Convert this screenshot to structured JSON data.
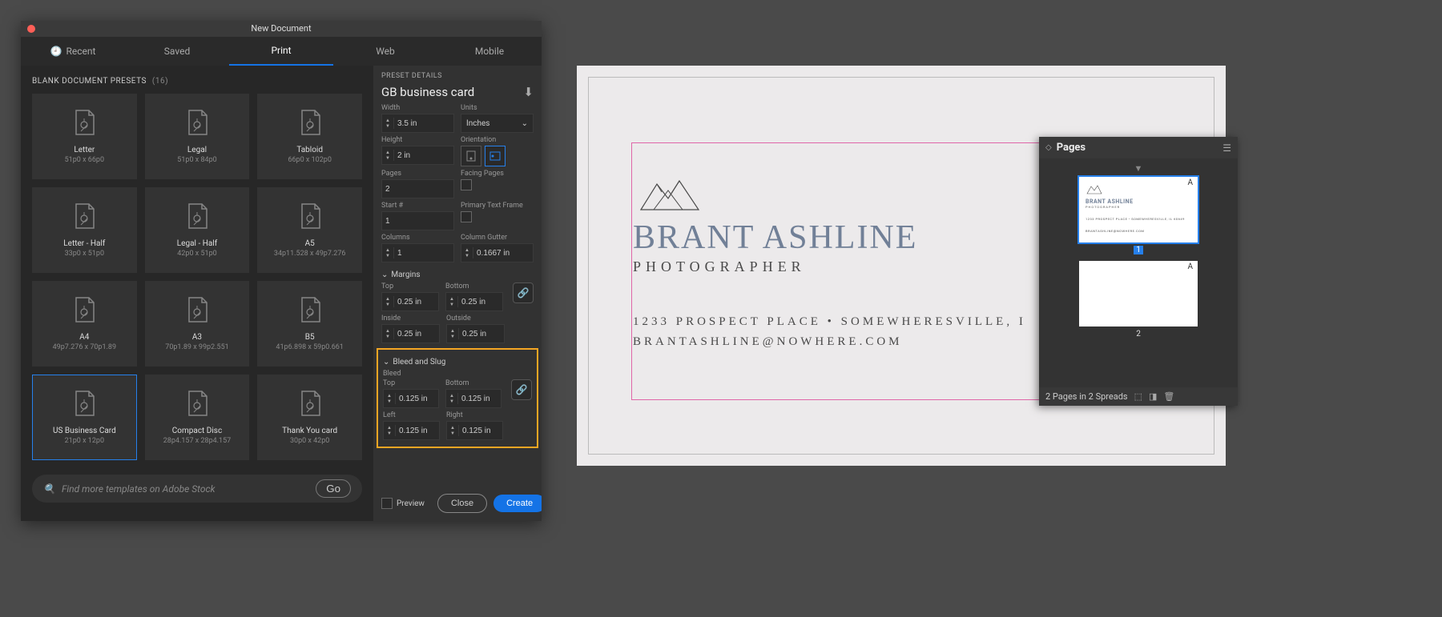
{
  "dialog": {
    "title": "New Document",
    "tabs": {
      "recent": "Recent",
      "saved": "Saved",
      "print": "Print",
      "web": "Web",
      "mobile": "Mobile"
    },
    "section_label": "BLANK DOCUMENT PRESETS",
    "preset_count": "(16)",
    "presets": [
      {
        "name": "Letter",
        "dim": "51p0 x 66p0"
      },
      {
        "name": "Legal",
        "dim": "51p0 x 84p0"
      },
      {
        "name": "Tabloid",
        "dim": "66p0 x 102p0"
      },
      {
        "name": "Letter - Half",
        "dim": "33p0 x 51p0"
      },
      {
        "name": "Legal - Half",
        "dim": "42p0 x 51p0"
      },
      {
        "name": "A5",
        "dim": "34p11.528 x 49p7.276"
      },
      {
        "name": "A4",
        "dim": "49p7.276 x 70p1.89"
      },
      {
        "name": "A3",
        "dim": "70p1.89 x 99p2.551"
      },
      {
        "name": "B5",
        "dim": "41p6.898 x 59p0.661"
      },
      {
        "name": "US Business Card",
        "dim": "21p0 x 12p0"
      },
      {
        "name": "Compact Disc",
        "dim": "28p4.157 x 28p4.157"
      },
      {
        "name": "Thank You card",
        "dim": "30p0 x 42p0"
      }
    ],
    "search_placeholder": "Find more templates on Adobe Stock",
    "go_label": "Go"
  },
  "details": {
    "head": "PRESET DETAILS",
    "doc_name": "GB business card",
    "labels": {
      "width": "Width",
      "units": "Units",
      "height": "Height",
      "orientation": "Orientation",
      "pages": "Pages",
      "facing": "Facing Pages",
      "start": "Start #",
      "primary": "Primary Text Frame",
      "columns": "Columns",
      "gutter": "Column Gutter",
      "margins": "Margins",
      "top": "Top",
      "bottom": "Bottom",
      "inside": "Inside",
      "outside": "Outside",
      "bleed_slug": "Bleed and Slug",
      "bleed": "Bleed",
      "left": "Left",
      "right": "Right"
    },
    "values": {
      "width": "3.5 in",
      "units": "Inches",
      "height": "2 in",
      "pages": "2",
      "start": "1",
      "columns": "1",
      "gutter": "0.1667 in",
      "margin_top": "0.25 in",
      "margin_bottom": "0.25 in",
      "margin_inside": "0.25 in",
      "margin_outside": "0.25 in",
      "bleed_top": "0.125 in",
      "bleed_bottom": "0.125 in",
      "bleed_left": "0.125 in",
      "bleed_right": "0.125 in"
    },
    "preview": "Preview",
    "close": "Close",
    "create": "Create"
  },
  "card": {
    "name": "BRANT ASHLINE",
    "role": "PHOTOGRAPHER",
    "addr": "1233 PROSPECT PLACE  •  SOMEWHERESVILLE, I",
    "email": "BRANTASHLINE@NOWHERE.COM"
  },
  "pages_panel": {
    "title": "Pages",
    "page1_master": "A",
    "page2_master": "A",
    "page1_num": "1",
    "page2_num": "2",
    "thumb_name": "BRANT ASHLINE",
    "thumb_role": "PHOTOGRAPHER",
    "thumb_addr": "1233 PROSPECT PLACE  •  SOMEWHERESVILLE, IL 60649",
    "thumb_email": "BRANTASHLINE@NOWHERE.COM",
    "footer": "2 Pages in 2 Spreads"
  }
}
